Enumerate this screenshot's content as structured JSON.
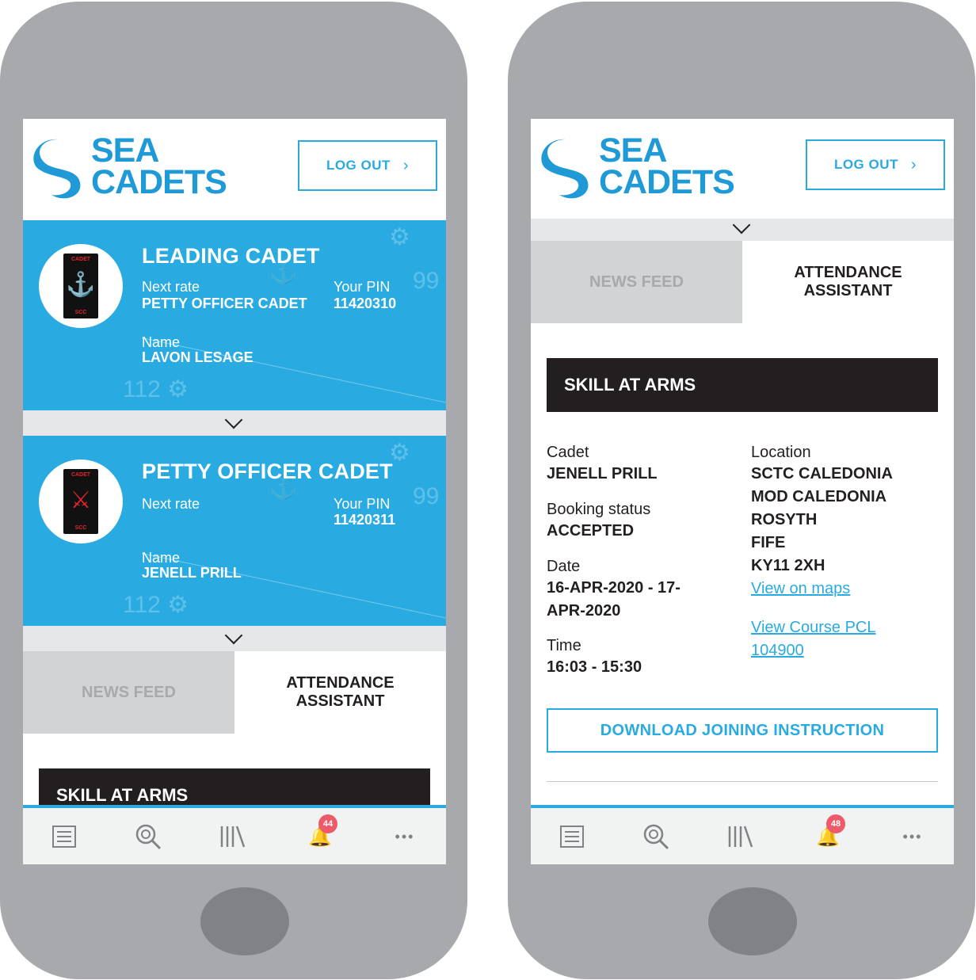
{
  "brand": {
    "logo_line1": "SEA",
    "logo_line2": "CADETS",
    "logout_label": "LOG OUT",
    "logout_chevron": "›",
    "brand_blue": "#29abe2",
    "logo_blue": "#1f9ad6"
  },
  "left_phone": {
    "cards": [
      {
        "title": "LEADING CADET",
        "next_rate_label": "Next rate",
        "next_rate_value": "PETTY OFFICER CADET",
        "pin_label": "Your PIN",
        "pin_value": "11420310",
        "name_label": "Name",
        "name_value": "LAVON LESAGE",
        "badge_top": "CADET",
        "badge_bottom": "SCC",
        "badge_icon": "anchor-icon"
      },
      {
        "title": "PETTY OFFICER CADET",
        "next_rate_label": "Next rate",
        "next_rate_value": "",
        "pin_label": "Your PIN",
        "pin_value": "11420311",
        "name_label": "Name",
        "name_value": "JENELL PRILL",
        "badge_top": "CADET",
        "badge_bottom": "SCC",
        "badge_icon": "crossed-anchors-icon"
      }
    ],
    "tabs": [
      "NEWS FEED",
      "ATTENDANCE ASSISTANT"
    ],
    "section_title": "SKILL AT ARMS"
  },
  "right_phone": {
    "tabs": [
      "NEWS FEED",
      "ATTENDANCE ASSISTANT"
    ],
    "section_title": "SKILL AT ARMS",
    "cadet_label": "Cadet",
    "cadet_value": "JENELL PRILL",
    "booking_label": "Booking status",
    "booking_value": "ACCEPTED",
    "date_label": "Date",
    "date_line1": "16-APR-2020 - 17-",
    "date_line2": "APR-2020",
    "time_label": "Time",
    "time_value": "16:03 - 15:30",
    "location_label": "Location",
    "location_lines": [
      "SCTC CALEDONIA",
      "MOD CALEDONIA",
      "ROSYTH",
      "FIFE",
      "KY11 2XH"
    ],
    "view_maps_link": "View on maps",
    "course_link_line1": "View Course PCL",
    "course_link_line2": "104900",
    "download_button": "DOWNLOAD JOINING INSTRUCTION"
  },
  "navbar": {
    "items": [
      {
        "icon": "list-icon",
        "glyph": "☰"
      },
      {
        "icon": "search-icon",
        "glyph": "◎"
      },
      {
        "icon": "library-icon",
        "glyph": "|||\\"
      },
      {
        "icon": "bell-icon",
        "glyph": "🔔"
      },
      {
        "icon": "more-icon",
        "glyph": "•••"
      }
    ],
    "left_badge": "44",
    "right_badge": "48"
  }
}
